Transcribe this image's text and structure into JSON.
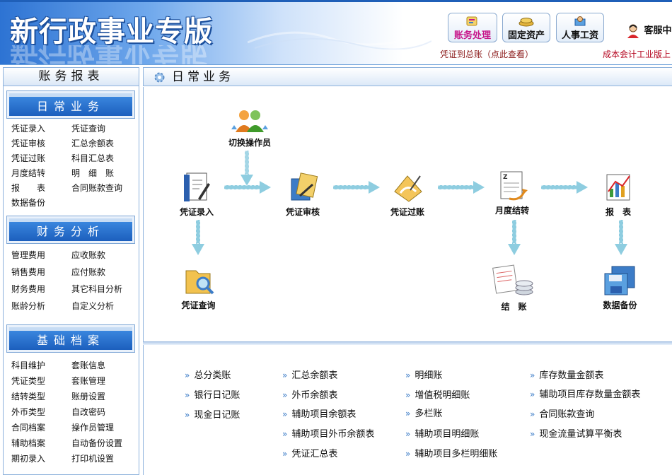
{
  "header": {
    "logo": "新行政事业专版",
    "buttons": [
      {
        "label": "账务处理",
        "icon": "accounting-icon"
      },
      {
        "label": "固定资产",
        "icon": "fixed-assets-icon"
      },
      {
        "label": "人事工资",
        "icon": "payroll-icon"
      }
    ],
    "service": "客服中",
    "link_left": "凭证到总账（点此查看）",
    "link_right": "成本会计工业版上"
  },
  "sidebar": {
    "title": "账务报表",
    "sections": [
      {
        "title": "日常业务",
        "items": [
          "凭证录入",
          "凭证查询",
          "凭证审核",
          "汇总余额表",
          "凭证过账",
          "科目汇总表",
          "月度结转",
          "明　细　账",
          "报　　表",
          "合同账款查询",
          "数据备份"
        ]
      },
      {
        "title": "财务分析",
        "items": [
          "管理费用",
          "应收账款",
          "销售费用",
          "应付账款",
          "财务费用",
          "其它科目分析",
          "账龄分析",
          "自定义分析"
        ]
      },
      {
        "title": "基础档案",
        "items": [
          "科目维护",
          "套账信息",
          "凭证类型",
          "套账管理",
          "结转类型",
          "账册设置",
          "外币类型",
          "自改密码",
          "合同档案",
          "操作员管理",
          "辅助档案",
          "自动备份设置",
          "期初录入",
          "打印机设置"
        ]
      }
    ]
  },
  "main": {
    "title": "日常业务",
    "flow": {
      "switch_operator": "切换操作员",
      "voucher_entry": "凭证录入",
      "voucher_review": "凭证审核",
      "voucher_posting": "凭证过账",
      "month_end": "月度结转",
      "reports": "报　表",
      "voucher_query": "凭证查询",
      "closing": "结　账",
      "backup": "数据备份"
    },
    "links": {
      "col1": [
        "总分类账",
        "银行日记账",
        "现金日记账"
      ],
      "col2": [
        "汇总余额表",
        "外币余额表",
        "辅助项目余额表",
        "辅助项目外币余额表",
        "凭证汇总表"
      ],
      "col3": [
        "明细账",
        "增值税明细账",
        "多栏账",
        "辅助项目明细账",
        "辅助项目多栏明细账"
      ],
      "col4": [
        "库存数量金额表",
        "辅助项目库存数量金额表",
        "合同账款查询",
        "现金流量试算平衡表"
      ]
    }
  }
}
